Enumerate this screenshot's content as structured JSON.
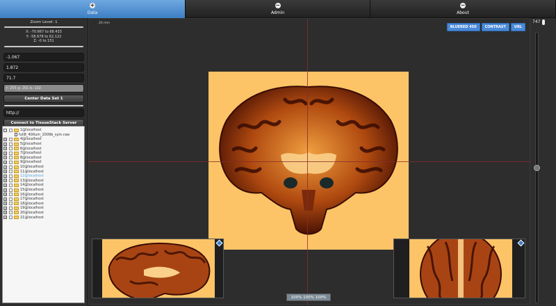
{
  "tabs": [
    {
      "label": "Data",
      "icon": "plus-icon"
    },
    {
      "label": "Admin",
      "icon": "minus-icon"
    },
    {
      "label": "About",
      "icon": "minus-icon"
    }
  ],
  "left": {
    "zoom_label": "Zoom Level: 1",
    "coords": [
      "X: -70.667 to 68.433",
      "Y: -58.678 to 62.122",
      "Z: -0 to 151"
    ],
    "x_value": "-1.067",
    "y_value": "1.872",
    "z_value": "71.7",
    "pixel_value": "r: 255 g: 201 b: 102",
    "center_button": "Center Data Set 1",
    "url_value": "http://",
    "connect_button": "Connect to TissueStack Server"
  },
  "tree": [
    {
      "name": "1@localhost",
      "expand": "-",
      "type": "folder",
      "indent": false,
      "checked": true
    },
    {
      "name": "full8_400um_2009b_sym.raw",
      "expand": "",
      "type": "file",
      "indent": true
    },
    {
      "name": "4@localhost",
      "expand": "+",
      "type": "folder",
      "indent": false
    },
    {
      "name": "5@localhost",
      "expand": "+",
      "type": "folder",
      "indent": false
    },
    {
      "name": "6@localhost",
      "expand": "+",
      "type": "folder",
      "indent": false
    },
    {
      "name": "7@localhost",
      "expand": "+",
      "type": "folder",
      "indent": false
    },
    {
      "name": "8@localhost",
      "expand": "+",
      "type": "folder",
      "indent": false
    },
    {
      "name": "9@localhost",
      "expand": "+",
      "type": "folder",
      "indent": false
    },
    {
      "name": "10@localhost",
      "expand": "+",
      "type": "folder",
      "indent": false
    },
    {
      "name": "11@localhost",
      "expand": "+",
      "type": "folder",
      "indent": false
    },
    {
      "name": "12@localhost",
      "expand": "+",
      "type": "folder",
      "indent": false,
      "selected": true
    },
    {
      "name": "13@localhost",
      "expand": "+",
      "type": "folder",
      "indent": false
    },
    {
      "name": "14@localhost",
      "expand": "+",
      "type": "folder",
      "indent": false
    },
    {
      "name": "15@localhost",
      "expand": "+",
      "type": "folder",
      "indent": false
    },
    {
      "name": "16@localhost",
      "expand": "+",
      "type": "folder",
      "indent": false
    },
    {
      "name": "17@localhost",
      "expand": "+",
      "type": "folder",
      "indent": false
    },
    {
      "name": "18@localhost",
      "expand": "+",
      "type": "folder",
      "indent": false
    },
    {
      "name": "19@localhost",
      "expand": "+",
      "type": "folder",
      "indent": false
    },
    {
      "name": "20@localhost",
      "expand": "+",
      "type": "folder",
      "indent": false
    },
    {
      "name": "21@localhost",
      "expand": "+",
      "type": "folder",
      "indent": false
    }
  ],
  "viewer": {
    "scale_label": "20 mm",
    "buttons": [
      "BLUERED 450",
      "CONTRAST",
      "URL"
    ],
    "zoom_display": "100% 100% 100%"
  },
  "slider": {
    "value": "747",
    "position_fraction": 0.5
  },
  "colors": {
    "accent": "#3d7fc4",
    "background": "#fcc467",
    "tissue": "#7a2a0a"
  }
}
